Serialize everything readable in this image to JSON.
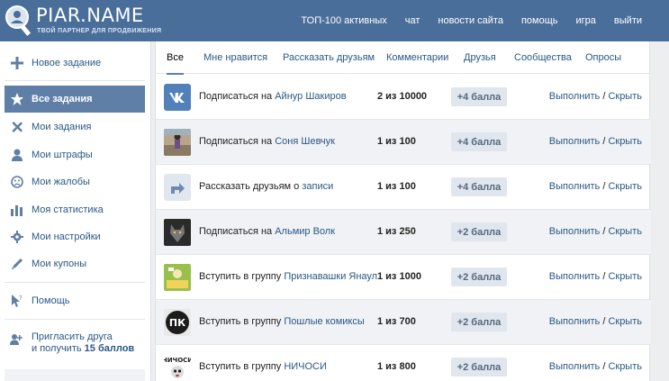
{
  "header": {
    "logo_title": "PIAR.NAME",
    "logo_subtitle": "ТВОЙ ПАРТНЕР ДЛЯ ПРОДВИЖЕНИЯ",
    "nav": [
      "ТОП-100 активных",
      "чат",
      "новости сайта",
      "помощь",
      "игра",
      "выйти"
    ]
  },
  "sidebar": {
    "new_task": "Новое задание",
    "items": [
      {
        "label": "Все задания",
        "icon": "star-icon",
        "active": true
      },
      {
        "label": "Мои задания",
        "icon": "tools-icon"
      },
      {
        "label": "Мои штрафы",
        "icon": "user-icon"
      },
      {
        "label": "Мои жалобы",
        "icon": "sad-face-icon"
      },
      {
        "label": "Моя статистика",
        "icon": "bar-chart-icon"
      },
      {
        "label": "Мои настройки",
        "icon": "gear-icon"
      },
      {
        "label": "Мои купоны",
        "icon": "pencil-icon"
      }
    ],
    "help": "Помощь",
    "invite_line1": "Пригласить друга",
    "invite_line2_prefix": "и получить ",
    "invite_bonus": "15 баллов"
  },
  "tabs": [
    "Все",
    "Мне нравится",
    "Рассказать друзьям",
    "Комментарии",
    "Друзья",
    "Сообщества",
    "Опросы"
  ],
  "tasks": [
    {
      "prefix": "Подписаться на ",
      "name": "Айнур Шакиров",
      "count": "2 из 10000",
      "points": "+4 балла",
      "thumb": "vk-logo-icon"
    },
    {
      "prefix": "Подписаться на ",
      "name": "Соня Шевчук",
      "count": "1 из 100",
      "points": "+4 балла",
      "thumb": "avatar-photo"
    },
    {
      "prefix": "Рассказать друзьям о ",
      "name": "записи",
      "count": "1 из 100",
      "points": "+4 балла",
      "thumb": "share-arrow-icon"
    },
    {
      "prefix": "Подписаться на ",
      "name": "Альмир Волк",
      "count": "1 из 250",
      "points": "+2 балла",
      "thumb": "wolf-avatar"
    },
    {
      "prefix": "Вступить в группу ",
      "name": "Признавашки Янаул",
      "count": "1 из 1000",
      "points": "+2 балла",
      "thumb": "group-avatar"
    },
    {
      "prefix": "Вступить в группу ",
      "name": "Пошлые комиксы",
      "count": "1 из 700",
      "points": "+2 балла",
      "thumb": "pk-logo"
    },
    {
      "prefix": "Вступить в группу ",
      "name": "НИЧОСИ",
      "count": "1 из 800",
      "points": "+2 балла",
      "thumb": "nichosi-logo"
    }
  ],
  "actions": {
    "do": "Выполнить",
    "sep": " / ",
    "hide": "Скрыть"
  },
  "colors": {
    "header": "#4a6e9a",
    "active": "#5f7fa6",
    "link": "#2a5885"
  }
}
